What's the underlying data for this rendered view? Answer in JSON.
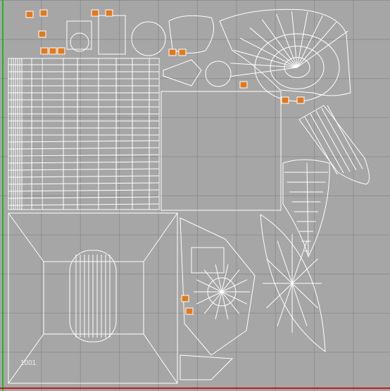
{
  "viewport": {
    "tile_label": "1001",
    "colors": {
      "background": "#a6a6a6",
      "grid": "#8f8f8f",
      "wire": "#ffffff",
      "x_axis": "#c61a1a",
      "y_axis": "#20b52a",
      "selected_face": "#e07a1f"
    }
  }
}
